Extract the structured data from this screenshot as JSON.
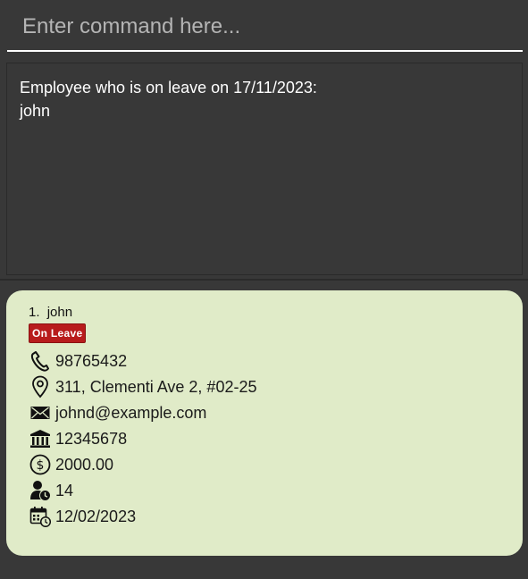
{
  "command": {
    "placeholder": "Enter command here...",
    "value": ""
  },
  "result": {
    "lines": [
      "Employee who is on leave on 17/11/2023:",
      "john"
    ]
  },
  "employees": [
    {
      "index": "1.",
      "name": "john",
      "status_badge": "On Leave",
      "phone": "98765432",
      "address": "311, Clementi Ave 2, #02-25",
      "email": "johnd@example.com",
      "bank_account": "12345678",
      "salary": "2000.00",
      "leave_days": "14",
      "join_date": "12/02/2023"
    }
  ],
  "colors": {
    "background": "#383838",
    "card": "#e0ebc8",
    "badge": "#b81c1c",
    "text_light": "#ffffff"
  },
  "icons": {
    "phone": "phone-icon",
    "address": "location-pin-icon",
    "email": "envelope-icon",
    "bank": "bank-icon",
    "salary": "dollar-coin-icon",
    "leave": "user-clock-icon",
    "date": "calendar-clock-icon"
  }
}
